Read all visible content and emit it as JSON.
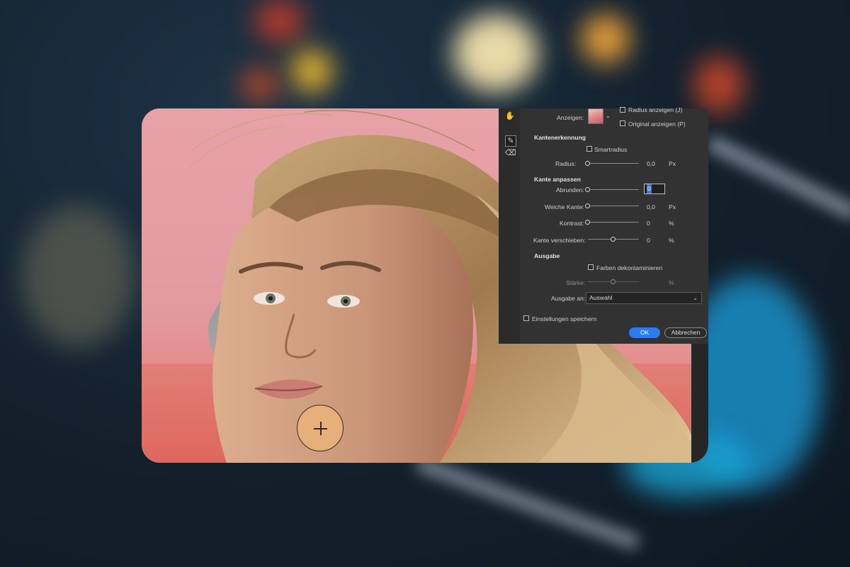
{
  "colors": {
    "panel_bg": "#323232",
    "accent_ok": "#2d7bef",
    "photo_bg": "#e7a2a8",
    "brush_fill": "#e7b07a"
  },
  "icons": {
    "hand": "hand-icon",
    "refine_brush": "refine-edge-brush-icon",
    "eraser": "eraser-icon",
    "brush_cursor": "brush-cursor-crosshair-icon"
  },
  "view": {
    "label": "Anzeigen:",
    "show_radius": "Radius anzeigen (J)",
    "show_original": "Original anzeigen (P)"
  },
  "edge_detection": {
    "heading": "Kantenerkennung",
    "smart_radius": "Smartradius",
    "radius_label": "Radius:",
    "radius_value": "0,0",
    "radius_unit": "Px"
  },
  "adjust_edge": {
    "heading": "Kante anpassen",
    "smooth_label": "Abrunden:",
    "smooth_value": "0",
    "feather_label": "Weiche Kante:",
    "feather_value": "0,0",
    "feather_unit": "Px",
    "contrast_label": "Kontrast:",
    "contrast_value": "0",
    "contrast_unit": "%",
    "shift_label": "Kante verschieben:",
    "shift_value": "0",
    "shift_unit": "%"
  },
  "output": {
    "heading": "Ausgabe",
    "decontaminate": "Farben dekontaminieren",
    "amount_label": "Stärke:",
    "amount_unit": "%",
    "output_to_label": "Ausgabe an:",
    "output_to_value": "Auswahl"
  },
  "footer": {
    "remember_settings": "Einstellungen speichern",
    "ok": "OK",
    "cancel": "Abbrechen"
  }
}
